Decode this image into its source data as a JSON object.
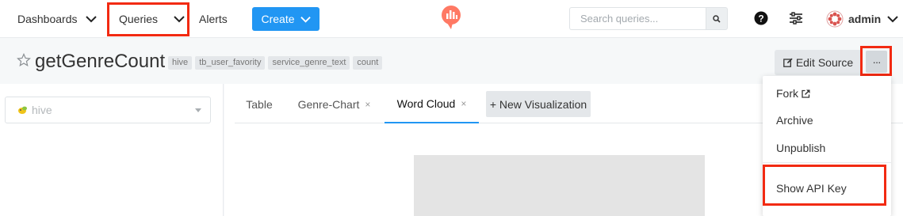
{
  "nav": {
    "dashboards": "Dashboards",
    "queries": "Queries",
    "alerts": "Alerts",
    "create": "Create",
    "search_placeholder": "Search queries...",
    "user": "admin"
  },
  "query": {
    "title": "getGenreCount",
    "tags": [
      "hive",
      "tb_user_favority",
      "service_genre_text",
      "count"
    ],
    "edit_source": "Edit Source",
    "more": "···"
  },
  "datasource": {
    "selected": "hive"
  },
  "tabs": [
    {
      "label": "Table",
      "closable": false
    },
    {
      "label": "Genre-Chart",
      "closable": true
    },
    {
      "label": "Word Cloud",
      "closable": true
    }
  ],
  "tab_close": "×",
  "new_visualization": "+ New Visualization",
  "menu": {
    "fork": "Fork",
    "archive": "Archive",
    "unpublish": "Unpublish",
    "show_api_key": "Show API Key"
  },
  "colors": {
    "accent": "#2196f3",
    "highlight": "#f22a12",
    "logo": "#ff7964"
  }
}
